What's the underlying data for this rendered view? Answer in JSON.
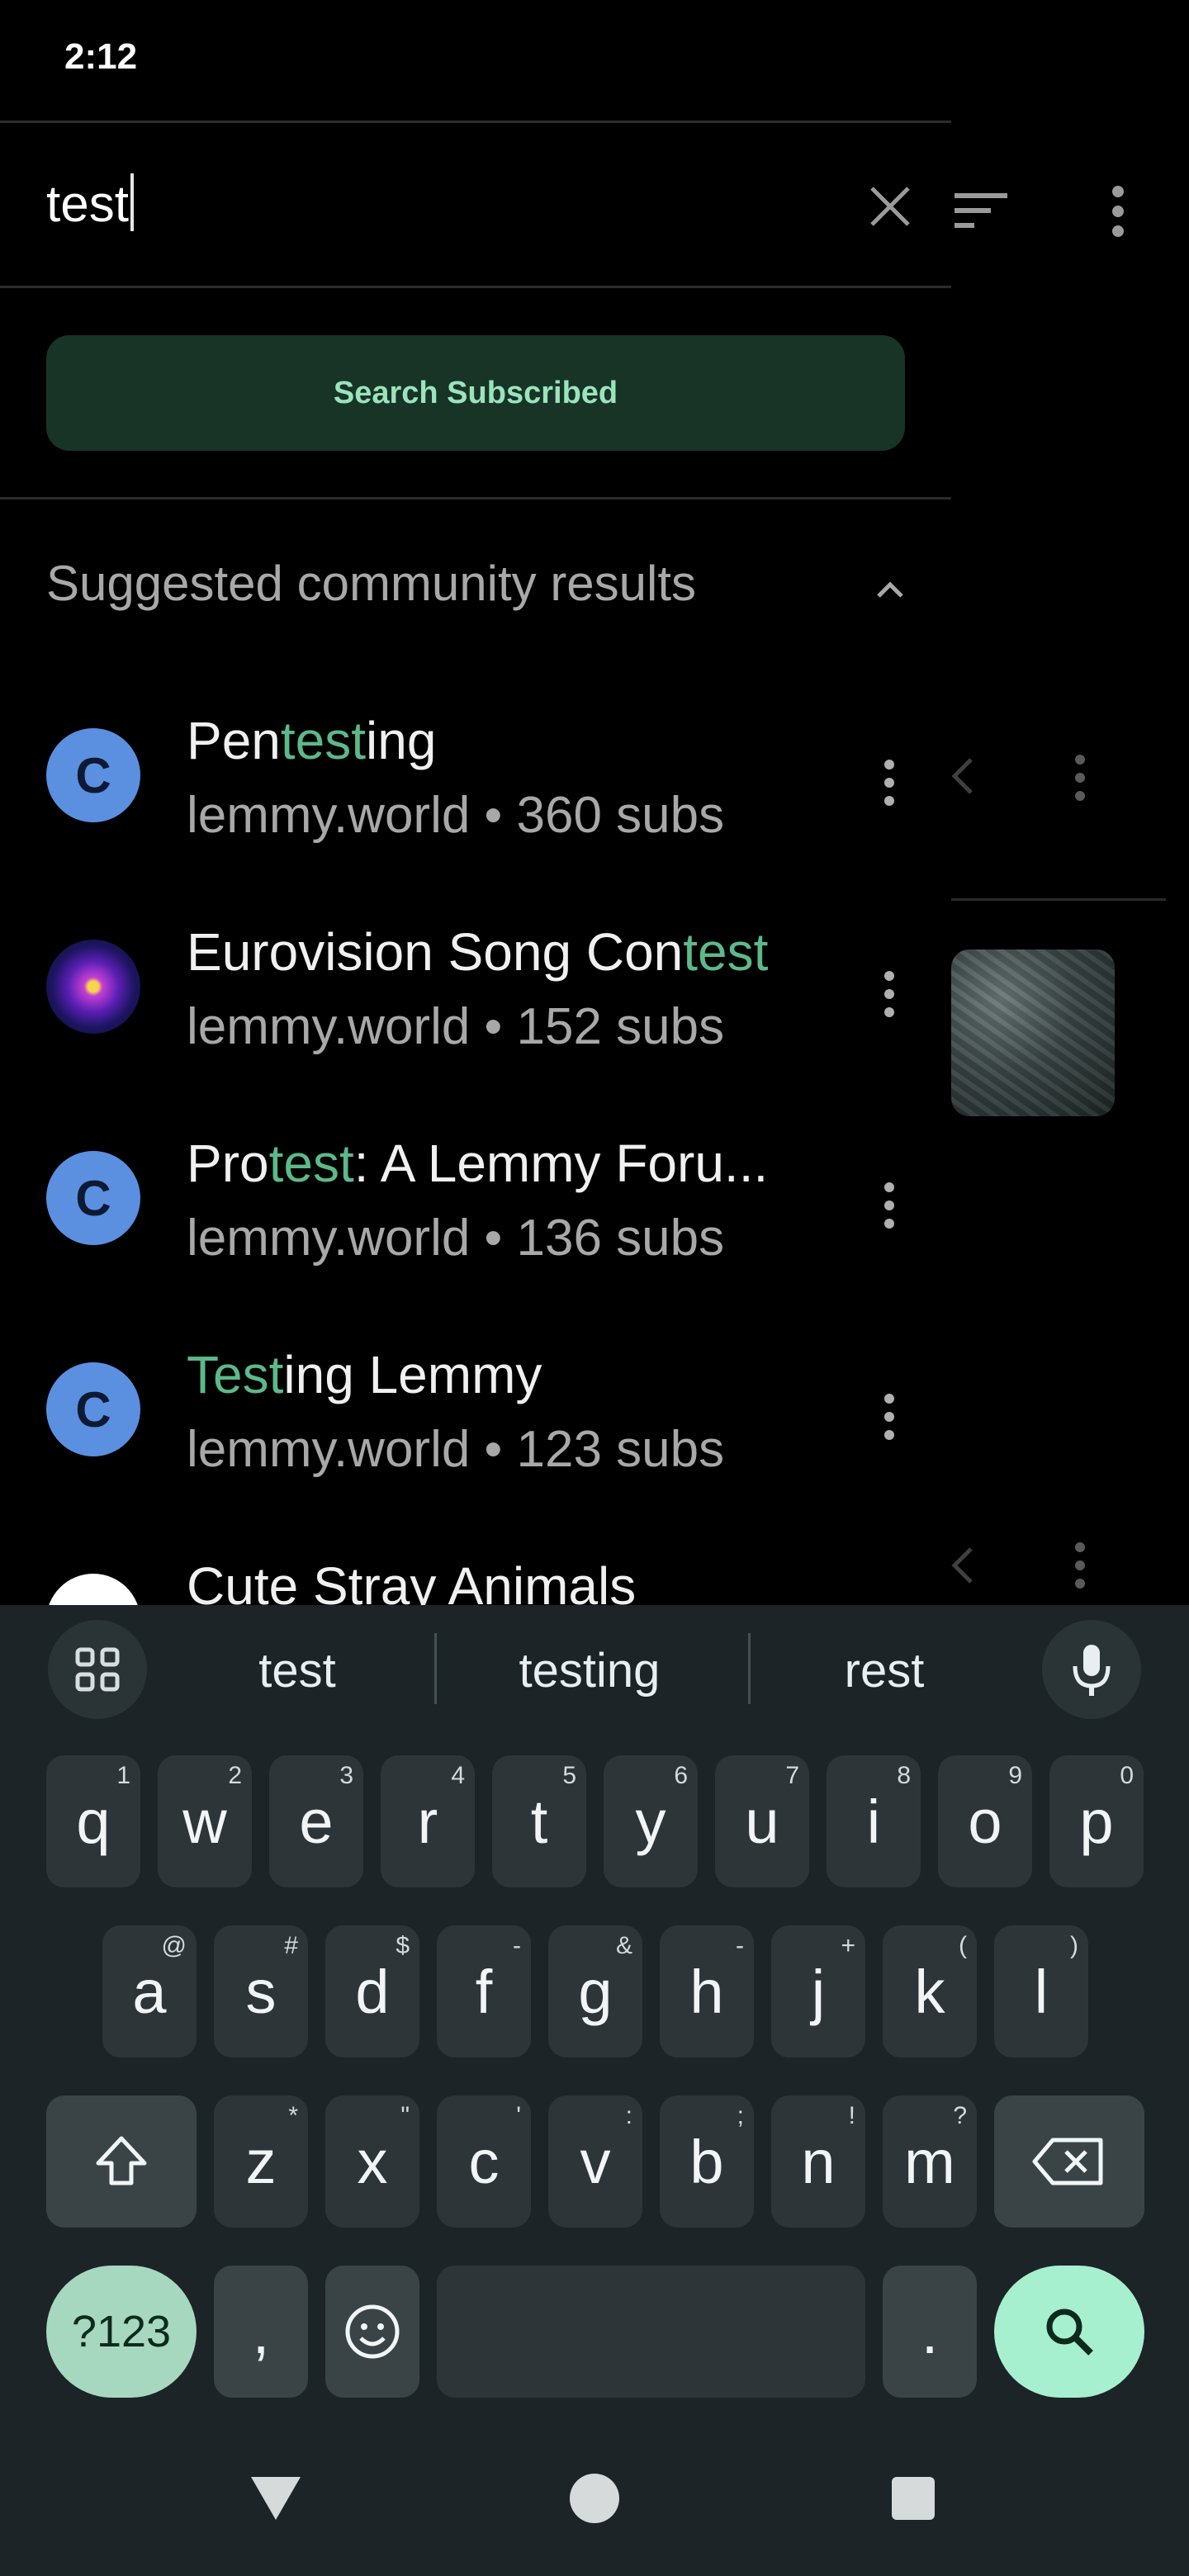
{
  "status": {
    "time": "2:12"
  },
  "search": {
    "query": "test"
  },
  "buttons": {
    "search_subscribed": "Search Subscribed"
  },
  "section": {
    "title": "Suggested community results"
  },
  "results": [
    {
      "avatar": "C",
      "name_parts": [
        "Pen",
        "test",
        "ing"
      ],
      "meta": "lemmy.world • 360 subs"
    },
    {
      "avatar": "",
      "name_parts": [
        "Eurovision Song Con",
        "test",
        ""
      ],
      "meta": "lemmy.world • 152 subs"
    },
    {
      "avatar": "C",
      "name_parts": [
        "Pro",
        "test",
        ": A Lemmy Foru..."
      ],
      "meta": "lemmy.world • 136 subs"
    },
    {
      "avatar": "C",
      "name_parts": [
        "",
        "Test",
        "ing Lemmy"
      ],
      "meta": "lemmy.world • 123 subs"
    },
    {
      "avatar": "",
      "name_parts": [
        "Cute Stray Animals",
        "",
        ""
      ],
      "meta": ""
    }
  ],
  "keyboard": {
    "suggestions": [
      "test",
      "testing",
      "rest"
    ],
    "row1": [
      [
        "q",
        "1"
      ],
      [
        "w",
        "2"
      ],
      [
        "e",
        "3"
      ],
      [
        "r",
        "4"
      ],
      [
        "t",
        "5"
      ],
      [
        "y",
        "6"
      ],
      [
        "u",
        "7"
      ],
      [
        "i",
        "8"
      ],
      [
        "o",
        "9"
      ],
      [
        "p",
        "0"
      ]
    ],
    "row2": [
      [
        "a",
        "@"
      ],
      [
        "s",
        "#"
      ],
      [
        "d",
        "$"
      ],
      [
        "f",
        "-"
      ],
      [
        "g",
        "&"
      ],
      [
        "h",
        "-"
      ],
      [
        "j",
        "+"
      ],
      [
        "k",
        "("
      ],
      [
        "l",
        ")"
      ]
    ],
    "row3": [
      [
        "z",
        "*"
      ],
      [
        "x",
        "\""
      ],
      [
        "c",
        "'"
      ],
      [
        "v",
        ":"
      ],
      [
        "b",
        ";"
      ],
      [
        "n",
        "!"
      ],
      [
        "m",
        "?"
      ]
    ],
    "symbols_key": "?123",
    "comma_key": ",",
    "period_key": "."
  },
  "colors": {
    "accent": "#5cb98a",
    "button_bg": "#173426",
    "button_text": "#9be3bd"
  }
}
